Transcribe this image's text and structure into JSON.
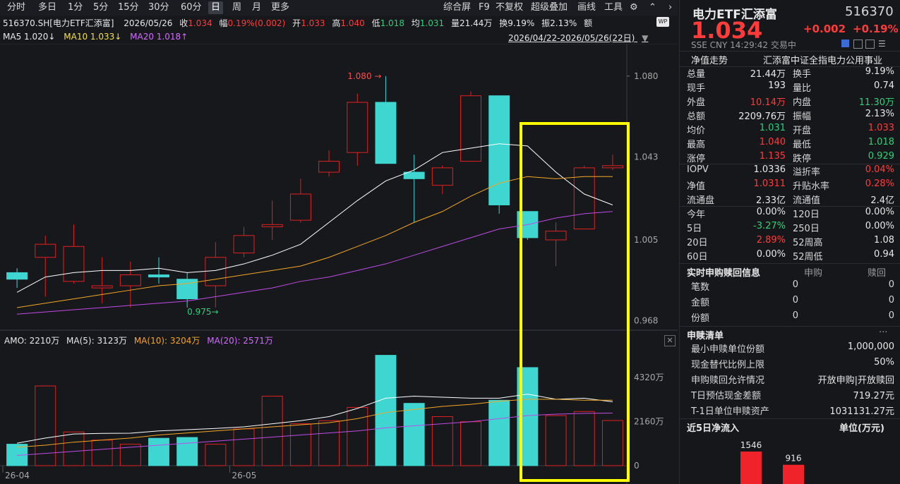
{
  "toolbar": {
    "left_tabs": [
      "分时",
      "多日",
      "1分",
      "5分",
      "15分",
      "30分",
      "60分",
      "日",
      "周",
      "月",
      "更多"
    ],
    "active_tab": "日",
    "right_items": [
      "综合屏",
      "F9",
      "不复权",
      "超级叠加",
      "画线",
      "工具"
    ]
  },
  "info_bar": {
    "symbol": "516370.SH[电力ETF汇添富]",
    "date": "2026/05/26",
    "close_label": "收",
    "close": "1.034",
    "change_label": "幅",
    "change": "0.19%(0.002)",
    "open_label": "开",
    "open": "1.033",
    "high_label": "高",
    "high": "1.040",
    "low_label": "低",
    "low": "1.018",
    "avg_label": "均",
    "avg": "1.031",
    "vol_label": "量",
    "volume": "21.44万",
    "turnover_label": "换",
    "turnover": "9.19%",
    "amp_label": "振",
    "amplitude": "2.13%",
    "amt_label": "额"
  },
  "ma_bar": {
    "ma5": "MA5 1.020↓",
    "ma10": "MA10 1.033↓",
    "ma20": "MA20 1.018↑",
    "range": "2026/04/22-2026/05/26(22日)",
    "wp_badge": "WP"
  },
  "vol_bar": {
    "amo": "AMO: 2210万",
    "ma5": "MA(5): 3123万",
    "ma10": "MA(10): 3204万",
    "ma20": "MA(20): 2571万"
  },
  "colors": {
    "up": "#e02020",
    "down": "#3fd5d0",
    "ma5": "#ffffff",
    "ma10": "#f5a623",
    "ma20": "#c04ae8",
    "highlight": "#ffff00"
  },
  "chart_data": {
    "type": "candlestick",
    "dates_axis_labels": [
      "26-04",
      "26-05"
    ],
    "price_axis": [
      "1.080",
      "1.043",
      "1.005",
      "0.968"
    ],
    "price_range": [
      0.963,
      1.089
    ],
    "annotations": {
      "high": "1.080",
      "low": "0.975"
    },
    "candles": [
      {
        "o": 0.99,
        "c": 0.987,
        "h": 0.992,
        "l": 0.983
      },
      {
        "o": 0.997,
        "c": 1.003,
        "h": 1.007,
        "l": 0.979
      },
      {
        "o": 0.986,
        "c": 1.002,
        "h": 1.012,
        "l": 0.985
      },
      {
        "o": 0.983,
        "c": 0.984,
        "h": 0.997,
        "l": 0.976
      },
      {
        "o": 0.984,
        "c": 0.989,
        "h": 0.995,
        "l": 0.974
      },
      {
        "o": 0.989,
        "c": 0.988,
        "h": 0.997,
        "l": 0.985
      },
      {
        "o": 0.987,
        "c": 0.978,
        "h": 0.99,
        "l": 0.974
      },
      {
        "o": 0.984,
        "c": 0.997,
        "h": 1.004,
        "l": 0.974
      },
      {
        "o": 0.999,
        "c": 1.007,
        "h": 1.011,
        "l": 0.997
      },
      {
        "o": 1.011,
        "c": 1.012,
        "h": 1.023,
        "l": 1.005
      },
      {
        "o": 1.014,
        "c": 1.026,
        "h": 1.033,
        "l": 1.013
      },
      {
        "o": 1.036,
        "c": 1.041,
        "h": 1.046,
        "l": 1.034
      },
      {
        "o": 1.045,
        "c": 1.068,
        "h": 1.072,
        "l": 1.039
      },
      {
        "o": 1.068,
        "c": 1.04,
        "h": 1.08,
        "l": 1.04
      },
      {
        "o": 1.036,
        "c": 1.033,
        "h": 1.044,
        "l": 1.013
      },
      {
        "o": 1.03,
        "c": 1.038,
        "h": 1.039,
        "l": 1.026
      },
      {
        "o": 1.041,
        "c": 1.071,
        "h": 1.073,
        "l": 1.041
      },
      {
        "o": 1.071,
        "c": 1.021,
        "h": 1.071,
        "l": 1.017
      },
      {
        "o": 1.018,
        "c": 1.006,
        "h": 1.018,
        "l": 1.005
      },
      {
        "o": 1.005,
        "c": 1.009,
        "h": 1.013,
        "l": 0.993
      },
      {
        "o": 1.01,
        "c": 1.038,
        "h": 1.039,
        "l": 1.01
      },
      {
        "o": 1.038,
        "c": 1.039,
        "h": 1.044,
        "l": 1.037
      }
    ],
    "ma5": [
      0.981,
      0.988,
      0.99,
      0.991,
      0.991,
      0.992,
      0.99,
      0.991,
      0.994,
      0.998,
      1.003,
      1.013,
      1.023,
      1.032,
      1.037,
      1.045,
      1.047,
      1.049,
      1.048,
      1.036,
      1.026,
      1.021
    ],
    "ma10": [
      0.974,
      0.976,
      0.978,
      0.98,
      0.982,
      0.984,
      0.985,
      0.987,
      0.989,
      0.991,
      0.993,
      0.997,
      1.002,
      1.007,
      1.013,
      1.018,
      1.025,
      1.031,
      1.034,
      1.033,
      1.034,
      1.034
    ],
    "ma20": [
      0.971,
      0.972,
      0.973,
      0.974,
      0.975,
      0.976,
      0.977,
      0.979,
      0.981,
      0.983,
      0.986,
      0.988,
      0.991,
      0.994,
      0.998,
      1.002,
      1.006,
      1.01,
      1.012,
      1.015,
      1.017,
      1.018
    ],
    "volume_axis": [
      "4320万",
      "2160万",
      "0"
    ],
    "volume_max_wan": 5800,
    "volumes_wan": [
      1050,
      3900,
      1650,
      1250,
      1050,
      1340,
      1380,
      1050,
      1800,
      3400,
      2050,
      2200,
      2850,
      5400,
      3050,
      2400,
      2150,
      3200,
      4800,
      2450,
      2650,
      2210
    ],
    "vol_ma5": [
      1100,
      1350,
      1550,
      1580,
      1590,
      1700,
      1760,
      1820,
      1900,
      2050,
      2200,
      2400,
      2800,
      3300,
      3400,
      3350,
      3300,
      3300,
      3500,
      3250,
      3300,
      3123
    ],
    "vol_ma10": [
      900,
      1000,
      1150,
      1250,
      1350,
      1500,
      1600,
      1700,
      1800,
      1900,
      2000,
      2100,
      2300,
      2600,
      2750,
      2900,
      3000,
      3150,
      3250,
      3250,
      3200,
      3204
    ],
    "vol_ma20": [
      500,
      600,
      700,
      800,
      900,
      1000,
      1100,
      1200,
      1300,
      1400,
      1500,
      1600,
      1700,
      1850,
      1950,
      2050,
      2150,
      2300,
      2450,
      2520,
      2560,
      2571
    ]
  },
  "right_panel": {
    "name": "电力ETF汇添富",
    "code": "516370",
    "price": "1.034",
    "change": "+0.002",
    "change_pct": "+0.19%",
    "meta": "SSE  CNY  14:29:42  交易中",
    "nav_trend_label": "净值走势",
    "index_name": "汇添富中证全指电力公用事业",
    "stats": [
      [
        "总量",
        "21.44万",
        "换手",
        "9.19%",
        "w",
        "w"
      ],
      [
        "现手",
        "193",
        "量比",
        "0.74",
        "w",
        "w"
      ],
      [
        "外盘",
        "10.14万",
        "内盘",
        "11.30万",
        "r",
        "g"
      ],
      [
        "总额",
        "2209.76万",
        "振幅",
        "2.13%",
        "w",
        "w"
      ],
      [
        "均价",
        "1.031",
        "开盘",
        "1.033",
        "g",
        "r"
      ],
      [
        "最高",
        "1.040",
        "最低",
        "1.018",
        "r",
        "g"
      ],
      [
        "涨停",
        "1.135",
        "跌停",
        "0.929",
        "r",
        "g"
      ]
    ],
    "stats2": [
      [
        "IOPV",
        "1.0336",
        "溢折率",
        "0.04%",
        "w",
        "r"
      ],
      [
        "净值",
        "1.0311",
        "升贴水率",
        "0.28%",
        "r",
        "r"
      ],
      [
        "流通盘",
        "2.33亿",
        "流通值",
        "2.4亿",
        "w",
        "w"
      ]
    ],
    "stats3": [
      [
        "今年",
        "0.00%",
        "120日",
        "0.00%",
        "w",
        "w"
      ],
      [
        "5日",
        "-3.27%",
        "250日",
        "0.00%",
        "g",
        "w"
      ],
      [
        "20日",
        "2.89%",
        "52周高",
        "1.08",
        "r",
        "w"
      ],
      [
        "60日",
        "0.00%",
        "52周低",
        "0.94",
        "w",
        "w"
      ]
    ],
    "subscribe_title": "实时申购赎回信息",
    "sub_col": "申购",
    "red_col": "赎回",
    "subscribe_rows": [
      [
        "笔数",
        "0",
        "0"
      ],
      [
        "金额",
        "0",
        "0"
      ],
      [
        "份额",
        "0",
        "0"
      ]
    ],
    "list_title": "申赎清单",
    "list_more": "···",
    "list_rows": [
      [
        "最小申赎单位份额",
        "1,000,000"
      ],
      [
        "现金替代比例上限",
        "50%"
      ],
      [
        "申购赎回允许情况",
        "开放申购|开放赎回"
      ],
      [
        "T日预估现金差额",
        "719.27元"
      ],
      [
        "T-1日单位申赎资产",
        "1031131.27元"
      ]
    ],
    "inflow_title": "近5日净流入",
    "inflow_unit": "单位(万元)",
    "inflow_values": [
      "1546",
      "916"
    ]
  }
}
